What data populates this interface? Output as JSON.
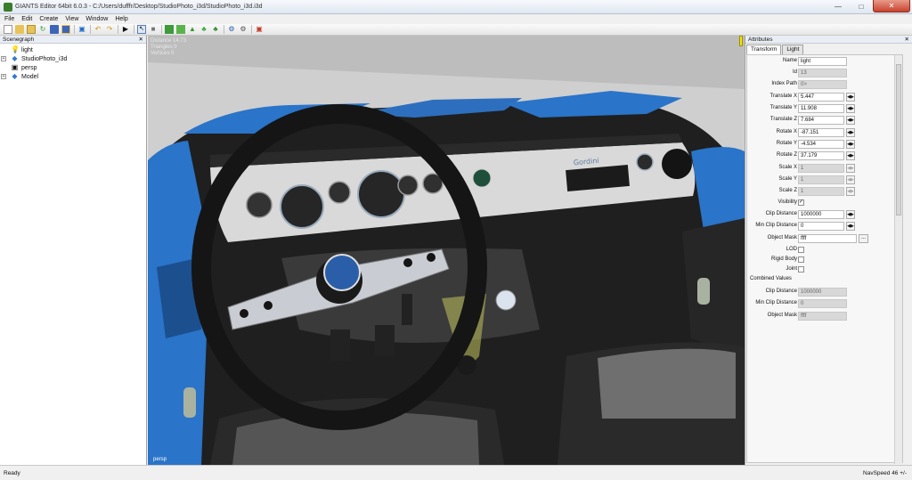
{
  "window": {
    "title": "GIANTS Editor 64bit 6.0.3 - C:/Users/dufffr/Desktop/StudioPhoto_i3d/StudioPhoto_i3d.i3d"
  },
  "menu": [
    "File",
    "Edit",
    "Create",
    "View",
    "Window",
    "Help"
  ],
  "scenegraph": {
    "title": "Scenegraph",
    "items": [
      {
        "label": "light",
        "icon": "bulb-icon",
        "expandable": false
      },
      {
        "label": "StudioPhoto_i3d",
        "icon": "transform-icon",
        "expandable": true
      },
      {
        "label": "persp",
        "icon": "camera-icon",
        "expandable": false
      },
      {
        "label": "Model",
        "icon": "transform-icon",
        "expandable": true
      }
    ]
  },
  "viewport": {
    "stats": [
      "Distance 14.73",
      "Triangles 0",
      "Vertices 0"
    ],
    "camera": "persp",
    "gauge_brand": "Gordini"
  },
  "attributes": {
    "title": "Attributes",
    "tabs": [
      "Transform",
      "Light"
    ],
    "fields": {
      "name": {
        "label": "Name",
        "value": "light"
      },
      "id": {
        "label": "Id",
        "value": "13"
      },
      "index_path": {
        "label": "Index Path",
        "value": "0>"
      },
      "translate_x": {
        "label": "Translate X",
        "value": "5.447"
      },
      "translate_y": {
        "label": "Translate Y",
        "value": "11.908"
      },
      "translate_z": {
        "label": "Translate Z",
        "value": "7.684"
      },
      "rotate_x": {
        "label": "Rotate X",
        "value": "-87.151"
      },
      "rotate_y": {
        "label": "Rotate Y",
        "value": "-4.534"
      },
      "rotate_z": {
        "label": "Rotate Z",
        "value": "37.179"
      },
      "scale_x": {
        "label": "Scale X",
        "value": "1"
      },
      "scale_y": {
        "label": "Scale Y",
        "value": "1"
      },
      "scale_z": {
        "label": "Scale Z",
        "value": "1"
      },
      "visibility": {
        "label": "Visibility",
        "checked": true
      },
      "clip_distance": {
        "label": "Clip Distance",
        "value": "1000000"
      },
      "min_clip_distance": {
        "label": "Min Clip Distance",
        "value": "0"
      },
      "object_mask": {
        "label": "Object Mask",
        "value": "ffff"
      },
      "lod": {
        "label": "LOD",
        "checked": false
      },
      "rigid_body": {
        "label": "Rigid Body",
        "checked": false
      },
      "joint": {
        "label": "Joint",
        "checked": false
      }
    },
    "combined": {
      "title": "Combined Values",
      "clip_distance": {
        "label": "Clip Distance",
        "value": "1000000"
      },
      "min_clip_distance": {
        "label": "Min Clip Distance",
        "value": "0"
      },
      "object_mask": {
        "label": "Object Mask",
        "value": "ffff"
      }
    }
  },
  "status": {
    "left": "Ready",
    "right": "NavSpeed 46 +/-"
  },
  "colors": {
    "car_body": "#2a74c9",
    "dashboard": "#d9d9d9",
    "interior": "#2b2b2b",
    "wheel": "#151515"
  }
}
